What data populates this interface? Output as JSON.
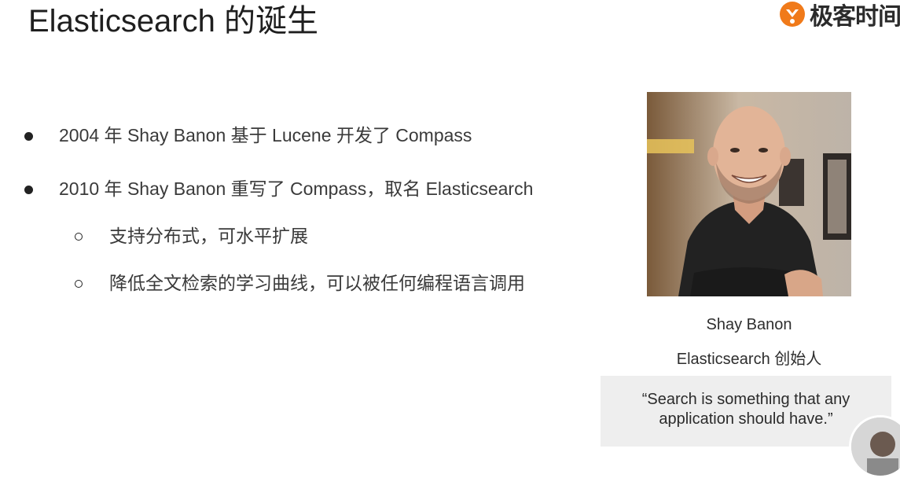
{
  "slide": {
    "title": "Elasticsearch 的诞生",
    "logo_text": "极客时间"
  },
  "bullets": [
    {
      "text": "2004 年 Shay Banon 基于 Lucene 开发了 Compass"
    },
    {
      "text": "2010 年 Shay Banon 重写了 Compass，取名 Elasticsearch"
    }
  ],
  "sub_bullets": [
    {
      "text": "支持分布式，可水平扩展"
    },
    {
      "text": "降低全文检索的学习曲线，可以被任何编程语言调用"
    }
  ],
  "profile": {
    "name": "Shay Banon",
    "role": "Elasticsearch 创始人"
  },
  "quote": {
    "line1": "“Search is something that any",
    "line2": "application should have.”"
  },
  "colors": {
    "accent_logo": "#f07a1a",
    "quote_bg": "#eeeeee"
  }
}
